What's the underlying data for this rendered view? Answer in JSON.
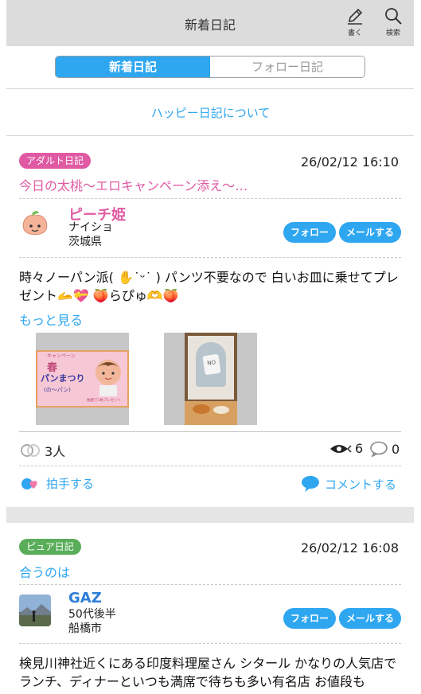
{
  "header": {
    "title": "新着日記",
    "write_label": "書く",
    "search_label": "検索"
  },
  "tabs": [
    {
      "label": "新着日記"
    },
    {
      "label": "フォロー日記"
    }
  ],
  "about_link": "ハッピー日記について",
  "entries": [
    {
      "badge": "アダルト日記",
      "date": "26/02/12 16:10",
      "title": "今日の太桃〜エロキャンペーン添え〜…",
      "user": {
        "name": "ピーチ姫",
        "line1": "ナイショ",
        "line2": "茨城県"
      },
      "follow_label": "フォロー",
      "mail_label": "メールする",
      "body": "時々ノーパン派( ✋˙ᵕ˙ ) パンツ不要なので 白いお皿に乗せてプレゼント🫴💝 🍑らぴゅ🫶🍑",
      "more_label": "もっと見る",
      "thumb1": {
        "l1": "キャンペーン",
        "l2": "春",
        "l3": "パンまつり",
        "l4": "(の〜パン)",
        "l5": "抽選で1枚プレゼント"
      },
      "thumb2": {
        "tag": "NO"
      },
      "likes": "3人",
      "views": "6",
      "comments": "0",
      "clap_label": "拍手する",
      "comment_label": "コメントする"
    },
    {
      "badge": "ピュア日記",
      "date": "26/02/12 16:08",
      "title": "合うのは",
      "user": {
        "name": "GAZ",
        "line1": "50代後半",
        "line2": "船橋市"
      },
      "follow_label": "フォロー",
      "mail_label": "メールする",
      "body": "検見川神社近くにある印度料理屋さん シタール かなりの人気店でランチ、ディナーといつも満席で待ちも多い有名店 お値段も"
    }
  ]
}
